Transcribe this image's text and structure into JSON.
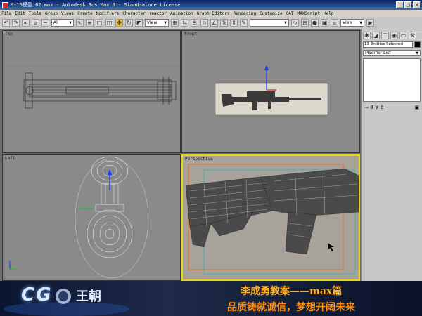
{
  "window": {
    "title": "M-16模型 02.max - Autodesk 3ds Max 8 - Stand-alone License",
    "controls": [
      "_",
      "□",
      "×"
    ]
  },
  "menu": [
    "File",
    "Edit",
    "Tools",
    "Group",
    "Views",
    "Create",
    "Modifiers",
    "Character",
    "reactor",
    "Animation",
    "Graph Editors",
    "Rendering",
    "Customize",
    "CAT",
    "MAXScript",
    "Help"
  ],
  "toolbar": {
    "selection_filter": "All",
    "reference_coord": "View",
    "named_selection": ""
  },
  "viewports": {
    "top": "Top",
    "front": "Front",
    "left": "Left",
    "perspective": "Perspective"
  },
  "command_panel": {
    "selection_field": "13 Entities Selected",
    "modifier_list": "Modifier List",
    "render_dropdown": "View"
  },
  "banner": {
    "logo": "CG",
    "logo_cn": "王朝",
    "title": "李成勇教案——max篇",
    "subtitle": "品质铸就诚信，梦想开阔未来"
  },
  "colors": {
    "active_viewport_border": "#e8d418",
    "title_text": "#ffb020",
    "subtitle_text": "#ff9010"
  }
}
